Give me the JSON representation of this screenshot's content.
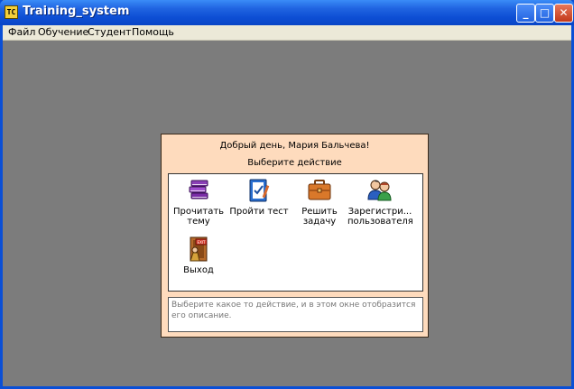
{
  "window": {
    "title": "Training_system",
    "app_icon_text": "ТС",
    "buttons": {
      "minimize": "_",
      "maximize": "□",
      "close": "✕"
    }
  },
  "menu": {
    "items": [
      "Файл",
      "Обучение",
      "Студент",
      "Помощь"
    ]
  },
  "panel": {
    "greeting": "Добрый день, Мария  Бальчева!",
    "prompt": "Выберите действие",
    "actions": [
      {
        "label": "Прочитать\nтему",
        "icon": "books-icon"
      },
      {
        "label": "Пройти тест",
        "icon": "test-clipboard-icon"
      },
      {
        "label": "Решить\nзадачу",
        "icon": "briefcase-icon"
      },
      {
        "label": "Зарегистри...\nпользователя",
        "icon": "users-icon"
      },
      {
        "label": "Выход",
        "icon": "exit-door-icon",
        "badge": "EXIT"
      }
    ],
    "description": "Выберите какое то действие, и в этом окне отобразится его описание."
  },
  "colors": {
    "titlebar": "#0d4ed4",
    "workspace": "#7c7c7c",
    "panel_bg": "#fedbbd"
  }
}
